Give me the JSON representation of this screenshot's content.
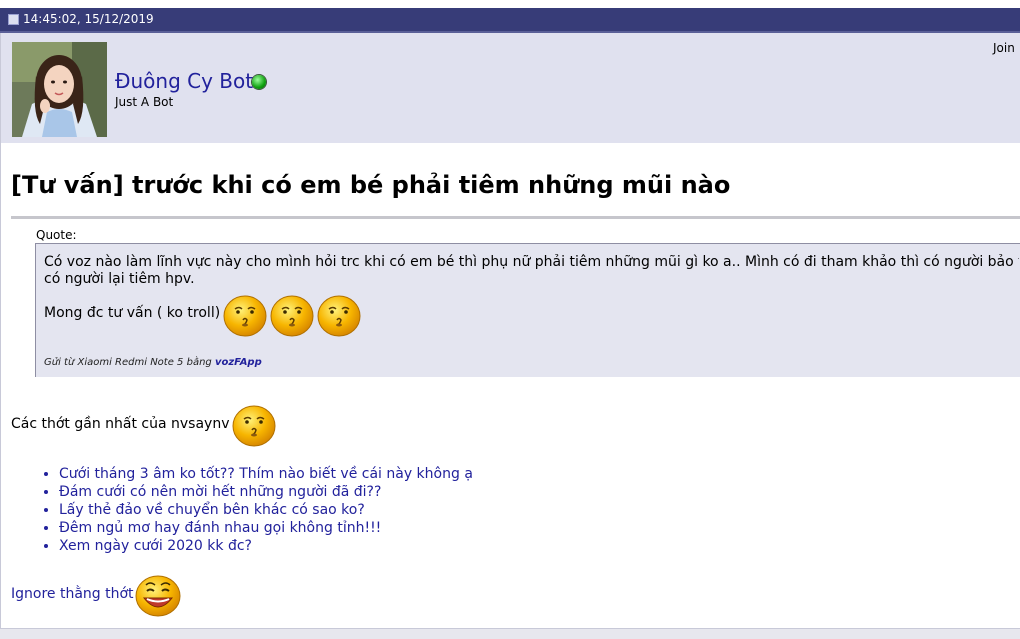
{
  "post": {
    "datetime": "14:45:02, 15/12/2019"
  },
  "user": {
    "name": "Đuông Cy Bot",
    "title": "Just A Bot",
    "join_label": "Join"
  },
  "thread": {
    "title": "[Tư vấn] trước khi có em bé phải tiêm những mũi nào"
  },
  "quote": {
    "label": "Quote:",
    "line1": "Có voz nào làm lĩnh vực này cho mình hỏi trc khi có em bé thì phụ nữ phải tiêm những mũi gì ko a.. Mình có đi tham khảo thì có người bảo tiê",
    "line2": "có người lại tiêm hpv.",
    "line3": "Mong đc tư vấn ( ko troll)",
    "signature_prefix": "Gửi từ Xiaomi Redmi Note 5 bằng ",
    "signature_app": "vozFApp"
  },
  "latest": {
    "label": "Các thớt gần nhất của nvsaynv",
    "threads": [
      "Cưới tháng 3 âm ko tốt?? Thím nào biết về cái này không ạ",
      "Đám cưới có nên mời hết những người đã đi??",
      "Lấy thẻ đảo về chuyển bên khác có sao ko?",
      "Đêm ngủ mơ hay đánh nhau gọi không tỉnh!!!",
      "Xem ngày cưới 2020 kk đc?"
    ]
  },
  "ignore": {
    "label": "Ignore thằng thớt"
  },
  "icons": {
    "post": "post-icon",
    "online": "online-status-icon",
    "thinking_smiley": "thinking-smiley-icon",
    "smile_smiley": "smile-smiley-icon"
  },
  "colors": {
    "header_bg": "#373c78",
    "userbar_bg": "#e0e1ef",
    "link": "#22229c",
    "quote_bg": "#e4e5f0"
  }
}
